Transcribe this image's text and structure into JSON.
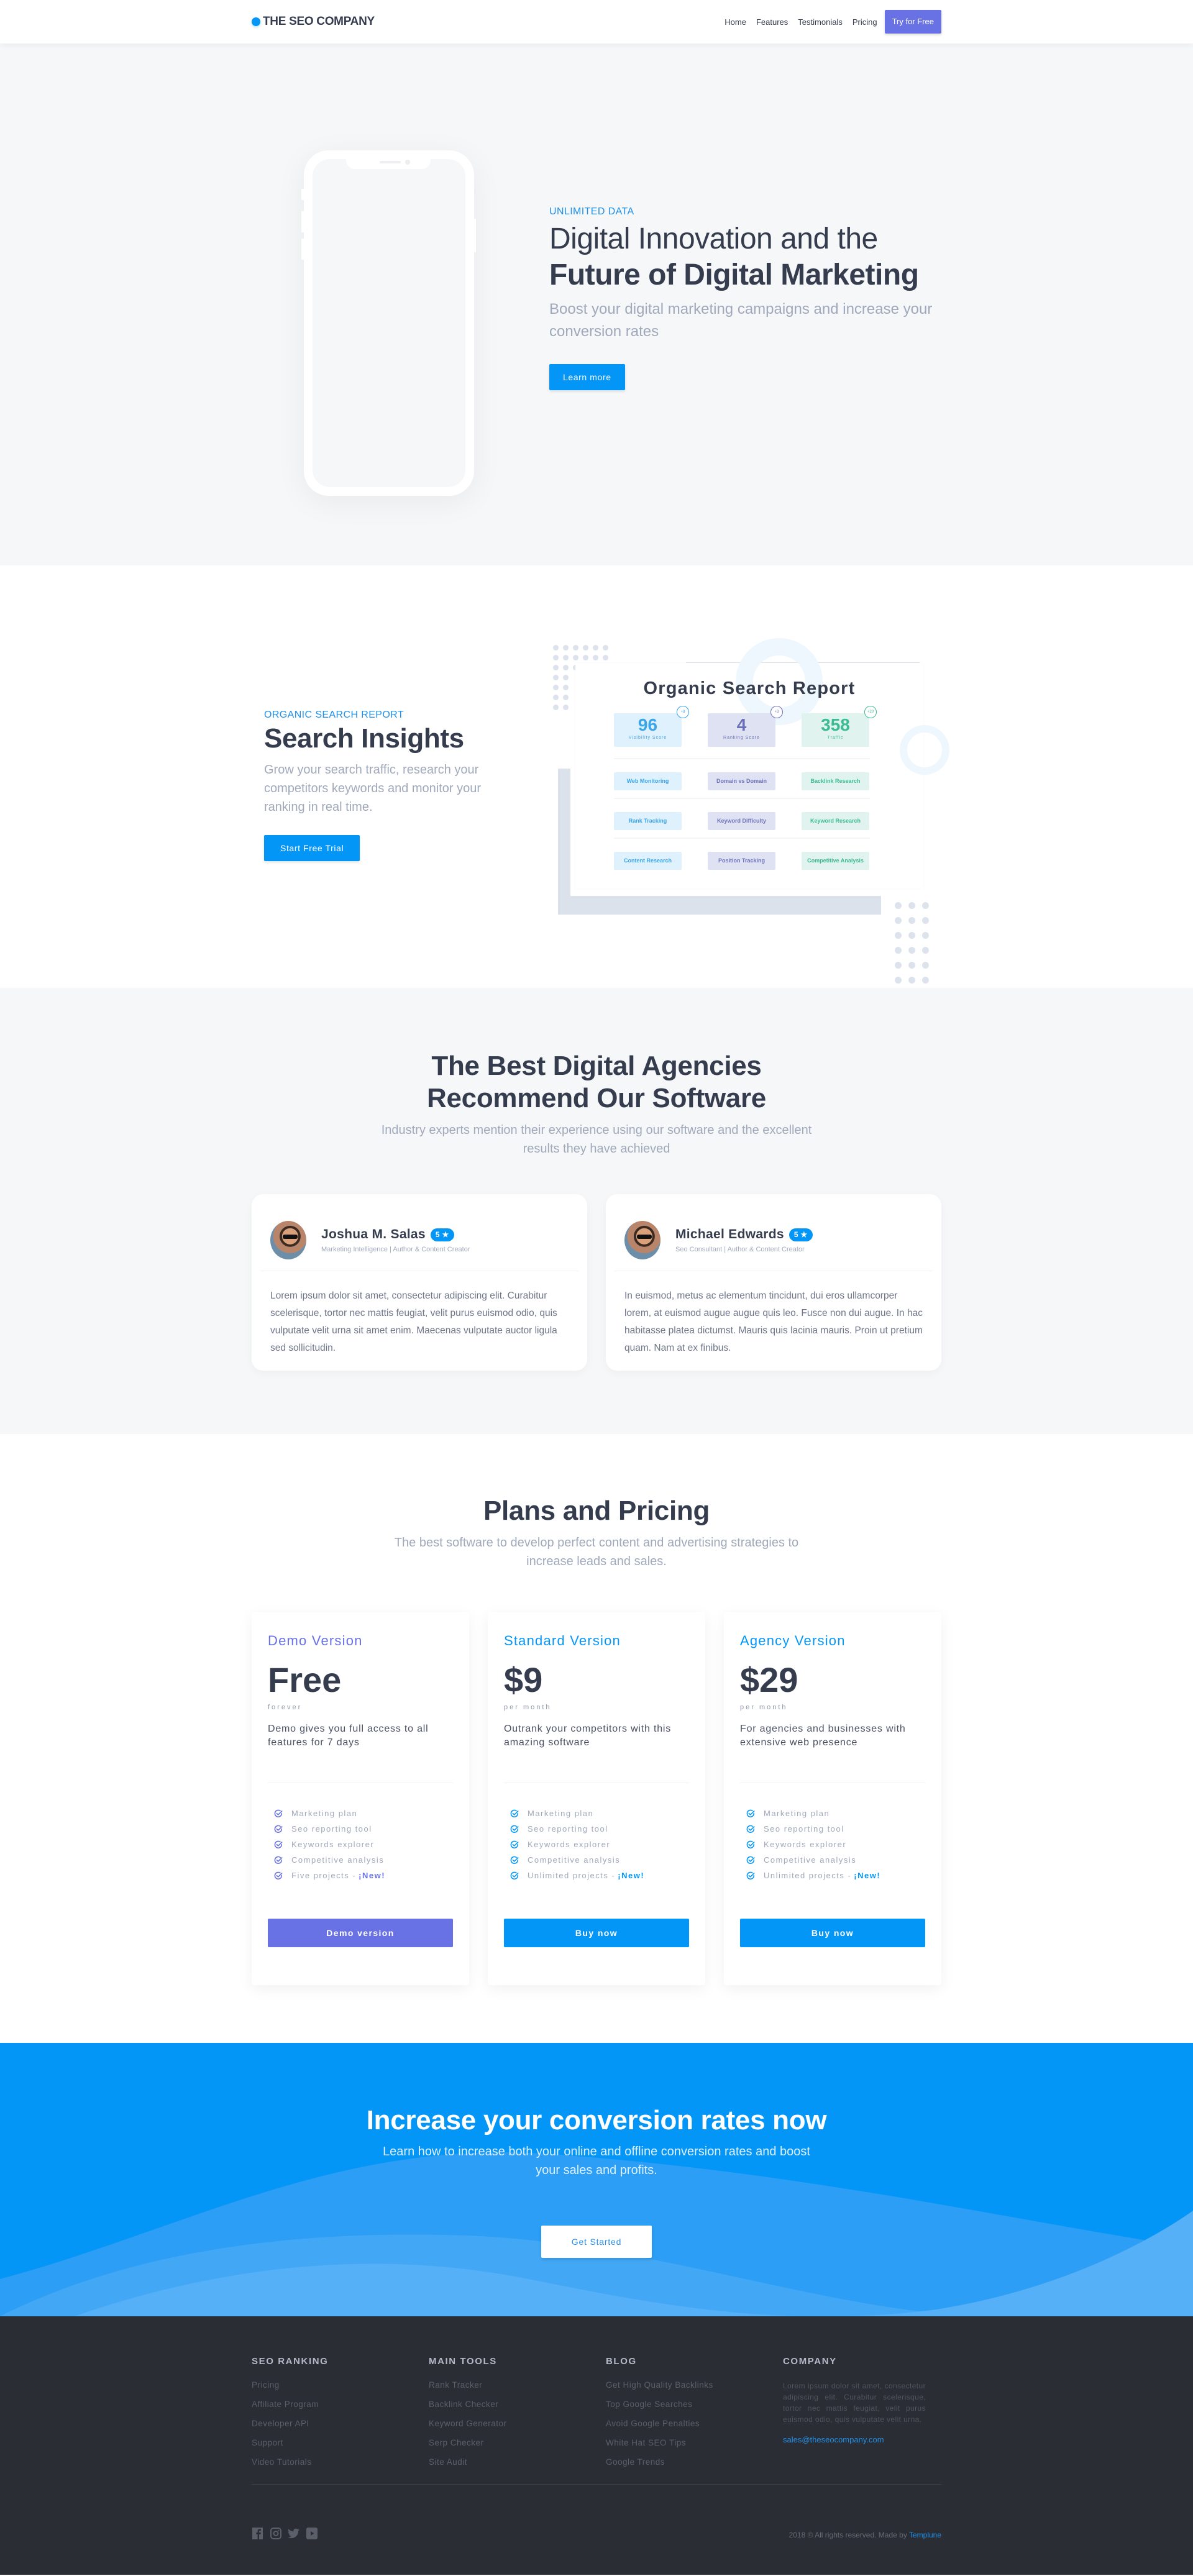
{
  "nav": {
    "brand": "THE SEO COMPANY",
    "links": [
      "Home",
      "Features",
      "Testimonials",
      "Pricing"
    ],
    "cta": "Try for Free"
  },
  "hero": {
    "eyebrow": "UNLIMITED DATA",
    "title_light": "Digital Innovation and the",
    "title_bold": "Future of Digital Marketing",
    "subtitle": "Boost your digital marketing campaigns and increase your conversion rates",
    "button": "Learn more"
  },
  "insights": {
    "eyebrow": "ORGANIC SEARCH REPORT",
    "title": "Search Insights",
    "subtitle": "Grow your search traffic, research your competitors keywords and monitor your ranking in real time.",
    "button": "Start Free Trial",
    "report": {
      "title": "Organic Search Report",
      "metrics": [
        {
          "value": "96",
          "label": "Visibility Score",
          "delta": "+8"
        },
        {
          "value": "4",
          "label": "Ranking Score",
          "delta": "+3"
        },
        {
          "value": "358",
          "label": "Traffic",
          "delta": "+20"
        }
      ],
      "rows": [
        [
          "Web Monitoring",
          "Domain vs Domain",
          "Backlink Research"
        ],
        [
          "Rank Tracking",
          "Keyword Difficulty",
          "Keyword Research"
        ],
        [
          "Content Research",
          "Position Tracking",
          "Competitive Analysis"
        ]
      ]
    }
  },
  "testimonials": {
    "title_line1": "The Best Digital Agencies",
    "title_line2": "Recommend Our Software",
    "subtitle": "Industry experts mention their experience using our software and the excellent results they have achieved",
    "items": [
      {
        "name": "Joshua M. Salas",
        "rating": "5 ★",
        "role": "Marketing Intelligence | Author & Content Creator",
        "text": "Lorem ipsum dolor sit amet, consectetur adipiscing elit. Curabitur scelerisque, tortor nec mattis feugiat, velit purus euismod odio, quis vulputate velit urna sit amet enim. Maecenas vulputate auctor ligula sed sollicitudin."
      },
      {
        "name": "Michael Edwards",
        "rating": "5 ★",
        "role": "Seo Consultant | Author & Content Creator",
        "text": "In euismod, metus ac elementum tincidunt, dui eros ullamcorper lorem, at euismod augue augue quis leo. Fusce non dui augue. In hac habitasse platea dictumst. Mauris quis lacinia mauris. Proin ut pretium quam. Nam at ex finibus."
      }
    ]
  },
  "pricing": {
    "title": "Plans and Pricing",
    "subtitle": "The best software to develop perfect content and advertising strategies to increase leads and sales.",
    "plans": [
      {
        "name": "Demo Version",
        "price": "Free",
        "period": "forever",
        "description": "Demo gives you full access to all features for 7 days",
        "features": [
          "Marketing plan",
          "Seo reporting tool",
          "Keywords explorer",
          "Competitive analysis",
          "Five projects -"
        ],
        "new_label": "¡New!",
        "button": "Demo version",
        "accent": "#6872e4"
      },
      {
        "name": "Standard Version",
        "price": "$9",
        "period": "per month",
        "description": "Outrank your competitors with this amazing software",
        "features": [
          "Marketing plan",
          "Seo reporting tool",
          "Keywords explorer",
          "Competitive analysis",
          "Unlimited projects -"
        ],
        "new_label": "¡New!",
        "button": "Buy now",
        "accent": "#0496f7"
      },
      {
        "name": "Agency Version",
        "price": "$29",
        "period": "per month",
        "description": "For agencies and businesses with extensive web presence",
        "features": [
          "Marketing plan",
          "Seo reporting tool",
          "Keywords explorer",
          "Competitive analysis",
          "Unlimited projects -"
        ],
        "new_label": "¡New!",
        "button": "Buy now",
        "accent": "#0496f7"
      }
    ]
  },
  "cta": {
    "title": "Increase your conversion rates now",
    "subtitle": "Learn how to increase both your online and offline conversion rates and boost your sales and profits.",
    "button": "Get Started"
  },
  "footer": {
    "columns": [
      {
        "title": "SEO RANKING",
        "links": [
          "Pricing",
          "Affiliate Program",
          "Developer API",
          "Support",
          "Video Tutorials"
        ]
      },
      {
        "title": "MAIN TOOLS",
        "links": [
          "Rank Tracker",
          "Backlink Checker",
          "Keyword Generator",
          "Serp Checker",
          "Site Audit"
        ]
      },
      {
        "title": "BLOG",
        "links": [
          "Get High Quality Backlinks",
          "Top Google Searches",
          "Avoid Google Penalties",
          "White Hat SEO Tips",
          "Google Trends"
        ]
      }
    ],
    "company": {
      "title": "COMPANY",
      "about": "Lorem ipsum dolor sit amet, consectetur adipiscing elit. Curabitur scelerisque, tortor nec mattis feugiat, velit purus euismod odio, quis vulputate velit urna.",
      "email": "sales@theseocompany.com"
    },
    "social": [
      "facebook-icon",
      "instagram-icon",
      "twitter-icon",
      "youtube-icon"
    ],
    "copyright": "2018 © All rights reserved. Made by",
    "credit": "Templune"
  },
  "colors": {
    "primary": "#0496f7",
    "secondary": "#6872e4",
    "text_dark": "#353c4e",
    "text_muted": "#a0a9bb",
    "footer_bg": "#2a2d33"
  }
}
